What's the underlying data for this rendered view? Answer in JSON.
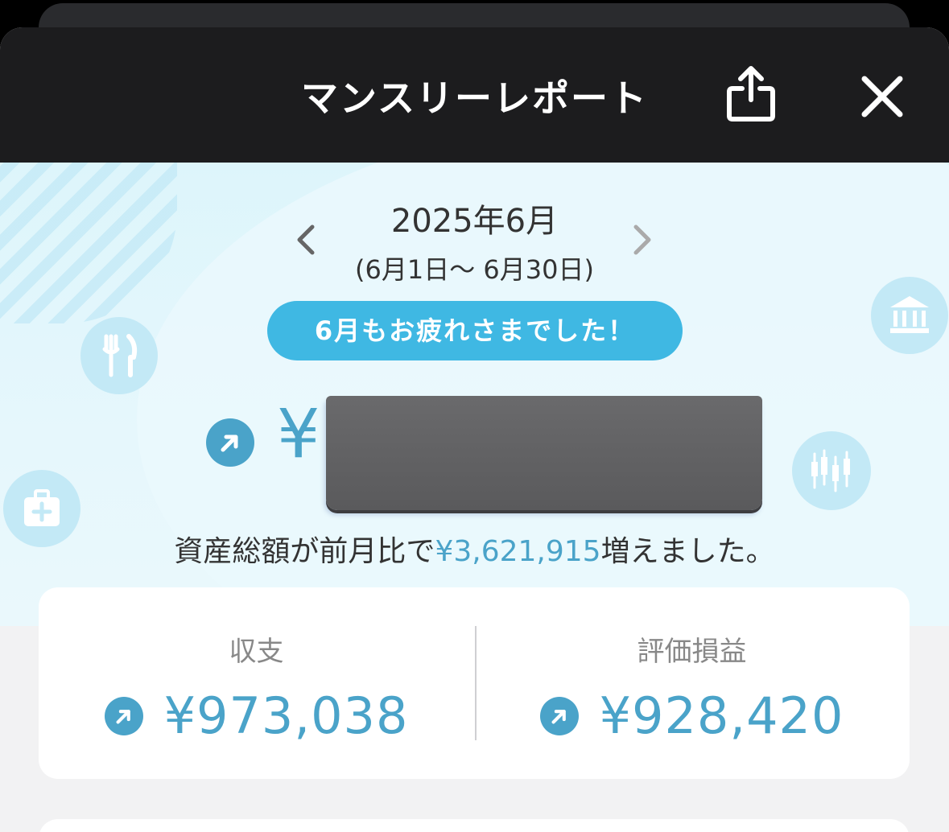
{
  "header": {
    "title": "マンスリーレポート",
    "share_icon": "share-icon",
    "close_icon": "close-icon"
  },
  "report": {
    "month": "2025年6月",
    "range": "(6月1日〜 6月30日)",
    "greeting": "6月もお疲れさまでした！",
    "total_prefix": "¥",
    "change_text_before": "資産総額が前月比で",
    "change_amount": "¥3,621,915",
    "change_text_after": "増えました。"
  },
  "summary": {
    "left": {
      "label": "収支",
      "value": "¥973,038",
      "trend": "up"
    },
    "right": {
      "label": "評価損益",
      "value": "¥928,420",
      "trend": "up"
    }
  },
  "colors": {
    "accent": "#4aa3c9",
    "pill": "#3fb8e3",
    "header_bg": "#1c1c1e",
    "hero_bg": "#ddf5fb"
  },
  "decor_icons": [
    "fork-knife-icon",
    "bank-icon",
    "candlestick-chart-icon",
    "medical-kit-icon"
  ]
}
